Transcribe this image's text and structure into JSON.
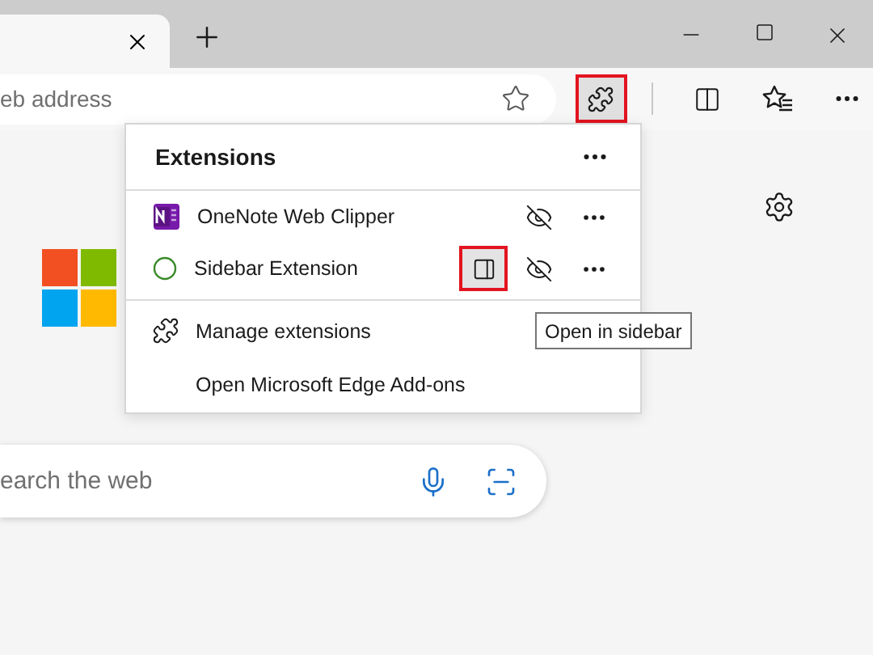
{
  "address_bar": {
    "placeholder": "eb address"
  },
  "toolbar": {
    "extensions_button": {
      "highlighted": true
    }
  },
  "extensions_menu": {
    "title": "Extensions",
    "extensions": [
      {
        "name": "OneNote Web Clipper",
        "kind": "onenote",
        "shown_in_toolbar": false
      },
      {
        "name": "Sidebar Extension",
        "kind": "sidebar",
        "shown_in_toolbar": false,
        "sidebar_button": {
          "highlighted": true
        }
      }
    ],
    "links": [
      {
        "label": "Manage extensions",
        "kind": "manage"
      },
      {
        "label": "Open Microsoft Edge Add-ons",
        "kind": "addons"
      }
    ]
  },
  "tooltip": {
    "text": "Open in sidebar"
  },
  "search": {
    "placeholder": "earch the web"
  }
}
